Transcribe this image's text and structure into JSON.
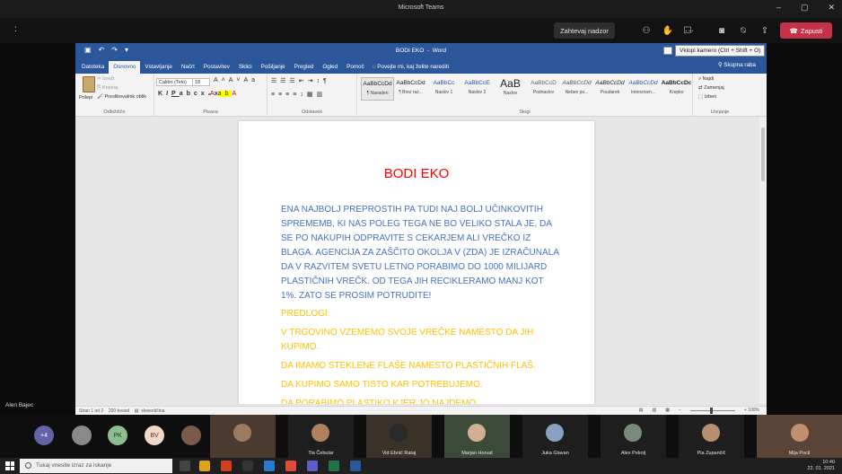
{
  "teams": {
    "window_title": "Microsoft Teams",
    "more_label": ":",
    "request_control": "Zahtevaj nadzor",
    "leave_label": "Zapusti",
    "presenter_name": "Alen Bajec"
  },
  "word": {
    "doc_name": "BODI EKO",
    "app_name": "Word",
    "tooltip": "Vklopi kamero (Ctrl + Shift + O)",
    "tabs": [
      "Datoteka",
      "Osnovno",
      "Vstavljanje",
      "Načrt",
      "Postavitev",
      "Sklici",
      "Pošiljanje",
      "Pregled",
      "Ogled",
      "Pomoč"
    ],
    "tell_me": "Povejte mi, kaj želite narediti",
    "share": "Skupna raba",
    "ribbon": {
      "paste": "Prilepi",
      "cut": "Izreži",
      "copy": "Kopiraj",
      "format_painter": "Preslikovalnik oblik",
      "clipboard_label": "Odložišče",
      "font_name": "Calibri (Telo)",
      "font_size": "18",
      "font_label": "Pisava",
      "paragraph_label": "Odstavek",
      "styles_label": "Slogi",
      "editing_label": "Urejanje",
      "find": "Najdi",
      "replace": "Zamenjaj",
      "select": "Izberi",
      "styles": [
        {
          "preview": "AaBbCcDd",
          "name": "¶ Navaden"
        },
        {
          "preview": "AaBbCcDd",
          "name": "¶ Brez raz..."
        },
        {
          "preview": "AaBbCc",
          "name": "Naslov 1"
        },
        {
          "preview": "AaBbCcE",
          "name": "Naslov 2"
        },
        {
          "preview": "AaB",
          "name": "Naslov"
        },
        {
          "preview": "AaBbCcD",
          "name": "Podnaslov"
        },
        {
          "preview": "AaBbCcDd",
          "name": "Neben po..."
        },
        {
          "preview": "AaBbCcDd",
          "name": "Poudarek"
        },
        {
          "preview": "AaBbCcDd",
          "name": "Intenziven..."
        },
        {
          "preview": "AaBbCcDc",
          "name": "Krepko"
        }
      ]
    },
    "document": {
      "title": "BODI EKO",
      "paragraph": "ENA NAJBOLJ PREPROSTIH PA TUDI NAJ BOLJ UČINKOVITIH SPREMEMB, KI NAS POLEG TEGA NE BO VELIKO STALA JE, DA SE PO NAKUPIH ODPRAVITE S CEKARJEM ALI VREČKO IZ BLAGA. AGENCIJA ZA ZAŠČITO OKOLJA V (ZDA) JE IZRAČUNALA DA V RAZVITEM SVETU LETNO PORABIMO DO 1000 MILIJARD PLASTIČNIH VREČK. OD TEGA JIH RECIKLERAMO MANJ KOT 1%. ZATO SE PROSIM POTRUDITE!",
      "suggestions_label": "PREDLOGI:",
      "items": [
        "V TRGOVINO VZEMEMO SVOJE VREČKE NAMESTO DA JIH KUPIMO.",
        "DA IMAMO STEKLENE FLAŠE NAMESTO PLASTIČNIH FLAŠ.",
        "DA KUPIMO SAMO TISTO KAR POTREBUJEMO.",
        "DA PORABIMO PLASTIKO KJER JO NAJDEMO."
      ]
    },
    "status": {
      "page": "Stran 1 od 2",
      "words": "200 besed",
      "language": "slovenščina",
      "zoom": "+ 100%"
    }
  },
  "participants": {
    "overflow": "+4",
    "initials": [
      {
        "text": "PK",
        "color": "#8cbd8c"
      },
      {
        "text": "BV",
        "color": "#f0d9c8"
      }
    ],
    "tiles": [
      "",
      "Tia Čebular",
      "Vid Ebnič Rataj",
      "Marjan Horvat",
      "Juka Glavan",
      "Alex Pekolj",
      "Pia Zupančič",
      "Mija Pocil"
    ]
  },
  "taskbar": {
    "search_placeholder": "Tukaj vnesite izraz za iskanje",
    "time": "10:40",
    "date": "22. 01. 2021"
  }
}
